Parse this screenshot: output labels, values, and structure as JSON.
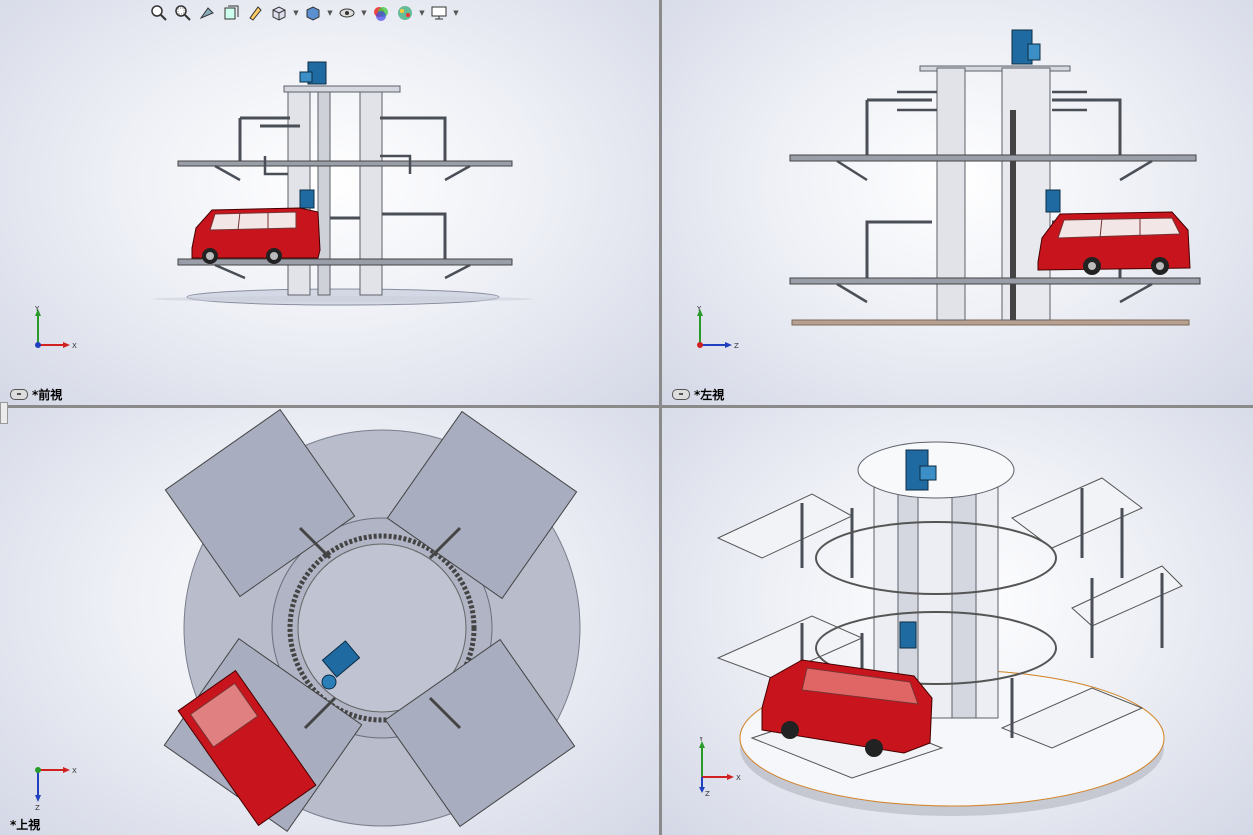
{
  "viewports": {
    "front": {
      "label": "*前視",
      "x_axis": "X",
      "y_axis": "Y"
    },
    "left": {
      "label": "*左視",
      "x_axis": "Z",
      "y_axis": "Y"
    },
    "top": {
      "label": "*上視",
      "x_axis": "X",
      "y_axis": "Z"
    },
    "iso": {
      "x_axis": "X",
      "y_axis": "Y",
      "z_axis": "Z"
    }
  },
  "toolbar": {
    "buttons": [
      {
        "icon": "zoom-to-fit-icon",
        "dropdown": false
      },
      {
        "icon": "zoom-to-area-icon",
        "dropdown": false
      },
      {
        "icon": "previous-view-icon",
        "dropdown": false
      },
      {
        "icon": "section-view-icon",
        "dropdown": false
      },
      {
        "icon": "dynamic-annotation-icon",
        "dropdown": false
      },
      {
        "icon": "view-orientation-icon",
        "dropdown": true
      },
      {
        "icon": "display-style-icon",
        "dropdown": true
      },
      {
        "icon": "hide-show-items-icon",
        "dropdown": true
      },
      {
        "icon": "edit-appearance-icon",
        "dropdown": false
      },
      {
        "icon": "apply-scene-icon",
        "dropdown": true
      },
      {
        "icon": "view-settings-icon",
        "dropdown": true
      }
    ]
  },
  "colors": {
    "frame": "#5c6068",
    "car": "#c8141c",
    "motor": "#2a7fb8",
    "base": "#c9cedc",
    "platform": "#e4e6ee"
  }
}
